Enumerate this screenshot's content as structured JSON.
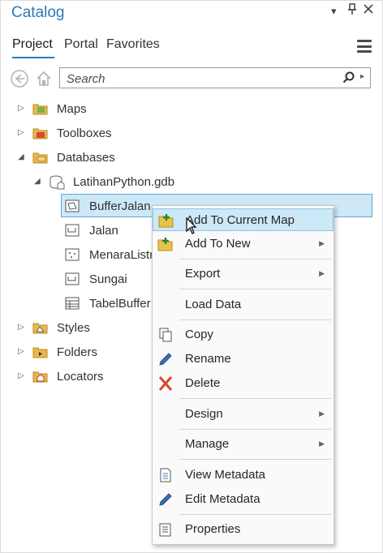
{
  "pane": {
    "title": "Catalog",
    "controls": {
      "dropdown": "▾",
      "pin": "📌",
      "close": "✕"
    }
  },
  "tabs": [
    {
      "label": "Project",
      "active": true
    },
    {
      "label": "Portal",
      "active": false
    },
    {
      "label": "Favorites",
      "active": false
    }
  ],
  "search": {
    "placeholder": "Search",
    "value": ""
  },
  "tree": {
    "maps": "Maps",
    "toolboxes": "Toolboxes",
    "databases": "Databases",
    "gdb": "LatihanPython.gdb",
    "items": [
      "BufferJalan",
      "Jalan",
      "MenaraListr",
      "Sungai",
      "TabelBuffer"
    ],
    "styles": "Styles",
    "folders": "Folders",
    "locators": "Locators"
  },
  "context_menu": {
    "add_current": "Add To Current Map",
    "add_new": "Add To New",
    "export": "Export",
    "load_data": "Load Data",
    "copy": "Copy",
    "rename": "Rename",
    "delete": "Delete",
    "design": "Design",
    "manage": "Manage",
    "view_metadata": "View Metadata",
    "edit_metadata": "Edit Metadata",
    "properties": "Properties"
  },
  "colors": {
    "accent": "#2a7ab8",
    "selection": "#cde8f7",
    "folder": "#e8b84a"
  }
}
